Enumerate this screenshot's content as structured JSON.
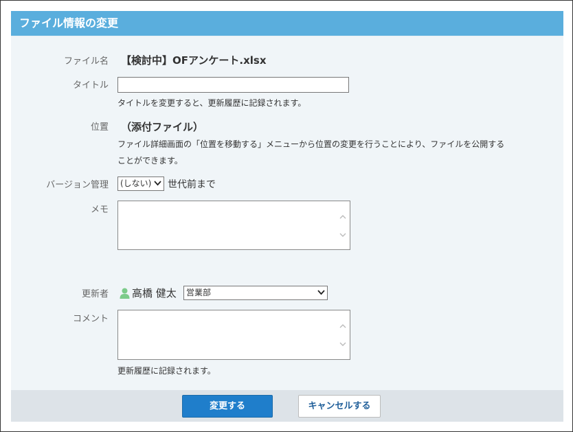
{
  "header": {
    "title": "ファイル情報の変更"
  },
  "form": {
    "file_name": {
      "label": "ファイル名",
      "value": "【検討中】OFアンケート.xlsx"
    },
    "title": {
      "label": "タイトル",
      "value": "",
      "hint": "タイトルを変更すると、更新履歴に記録されます。"
    },
    "location": {
      "label": "位置",
      "value": "（添付ファイル）",
      "hint_line1": "ファイル詳細画面の「位置を移動する」メニューから位置の変更を行うことにより、ファイルを公開する",
      "hint_line2": "ことができます。"
    },
    "version": {
      "label": "バージョン管理",
      "selected": "(しない)",
      "suffix": "世代前まで"
    },
    "memo": {
      "label": "メモ",
      "value": ""
    },
    "updater": {
      "label": "更新者",
      "name": "高橋 健太",
      "department": "営業部"
    },
    "comment": {
      "label": "コメント",
      "value": "",
      "hint": "更新履歴に記録されます。"
    }
  },
  "footer": {
    "submit_label": "変更する",
    "cancel_label": "キャンセルする"
  },
  "colors": {
    "header": "#5aaedd",
    "primary_button": "#1f7ecb",
    "user_icon": "#7ccb8a"
  }
}
